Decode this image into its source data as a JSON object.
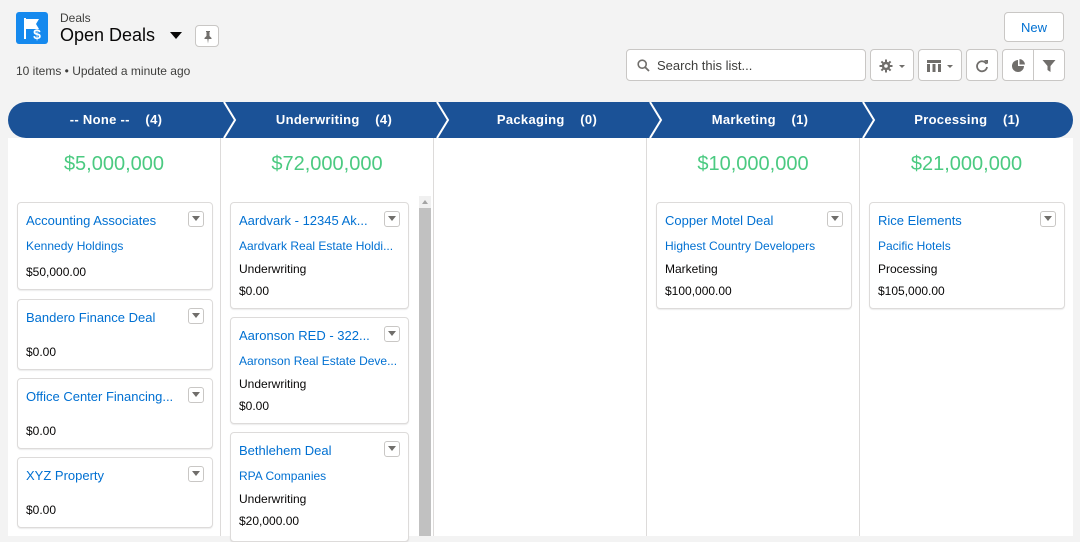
{
  "header": {
    "object_label": "Deals",
    "list_view_name": "Open Deals",
    "meta": "10 items • Updated a minute ago",
    "new_button": "New",
    "search_placeholder": "Search this list..."
  },
  "stages": [
    {
      "name": "-- None --",
      "count": "(4)",
      "label": "-- None --    (4)"
    },
    {
      "name": "Underwriting",
      "count": "(4)",
      "label": "Underwriting    (4)"
    },
    {
      "name": "Packaging",
      "count": "(0)",
      "label": "Packaging    (0)"
    },
    {
      "name": "Marketing",
      "count": "(1)",
      "label": "Marketing    (1)"
    },
    {
      "name": "Processing",
      "count": "(1)",
      "label": "Processing    (1)"
    }
  ],
  "columns": [
    {
      "total": "$5,000,000",
      "cards": [
        {
          "title": "Accounting Associates",
          "account": "Kennedy Holdings",
          "stage": "",
          "amount": "$50,000.00"
        },
        {
          "title": "Bandero Finance Deal",
          "account": "",
          "stage": "",
          "amount": "$0.00"
        },
        {
          "title": "Office Center Financing...",
          "account": "",
          "stage": "",
          "amount": "$0.00"
        },
        {
          "title": "XYZ Property",
          "account": "",
          "stage": "",
          "amount": "$0.00"
        }
      ]
    },
    {
      "total": "$72,000,000",
      "cards": [
        {
          "title": "Aardvark - 12345 Ak...",
          "account": "Aardvark Real Estate Holdi...",
          "stage": "Underwriting",
          "amount": "$0.00"
        },
        {
          "title": "Aaronson RED - 322...",
          "account": "Aaronson Real Estate Deve...",
          "stage": "Underwriting",
          "amount": "$0.00"
        },
        {
          "title": "Bethlehem Deal",
          "account": "RPA Companies",
          "stage": "Underwriting",
          "amount": "$20,000.00"
        }
      ]
    },
    {
      "total": "",
      "cards": []
    },
    {
      "total": "$10,000,000",
      "cards": [
        {
          "title": "Copper Motel Deal",
          "account": "Highest Country Developers",
          "stage": "Marketing",
          "amount": "$100,000.00"
        }
      ]
    },
    {
      "total": "$21,000,000",
      "cards": [
        {
          "title": "Rice Elements",
          "account": "Pacific Hotels",
          "stage": "Processing",
          "amount": "$105,000.00"
        }
      ]
    }
  ],
  "colors": {
    "stage_fill": "#1b5297",
    "total_green": "#4bca81",
    "link_blue": "#0070d2",
    "app_icon": "#1589ee"
  },
  "icons": [
    "flag-dollar-icon",
    "chevron-down-icon",
    "pin-icon",
    "search-icon",
    "gear-icon",
    "table-icon",
    "refresh-icon",
    "pie-chart-icon",
    "filter-icon"
  ]
}
